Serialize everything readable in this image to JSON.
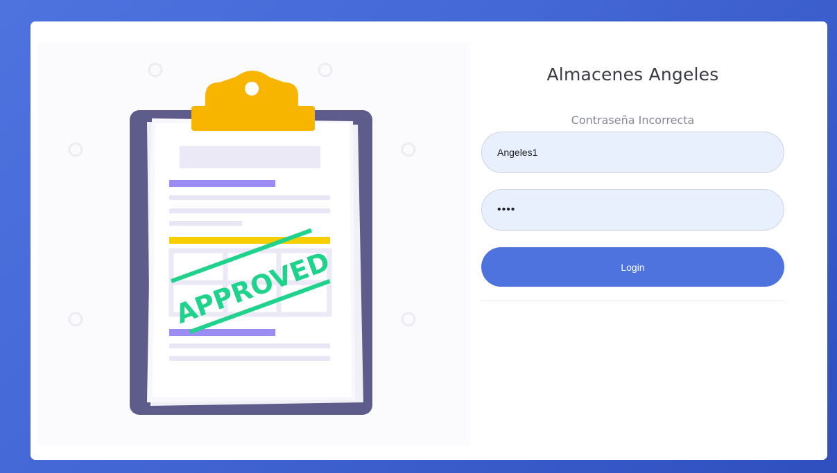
{
  "brand": {
    "title": "Almacenes Angeles"
  },
  "login": {
    "status_message": "Contraseña Incorrecta",
    "username_value": "Angeles1",
    "password_value": "****",
    "button_label": "Login"
  },
  "illustration": {
    "stamp_text": "APPROVED"
  },
  "colors": {
    "background": "#4e73df",
    "button": "#4e73df",
    "input_bg": "#e8f0fe",
    "clipboard": "#5e5c8a",
    "clip": "#f7b500",
    "stamp": "#1fd38c"
  }
}
